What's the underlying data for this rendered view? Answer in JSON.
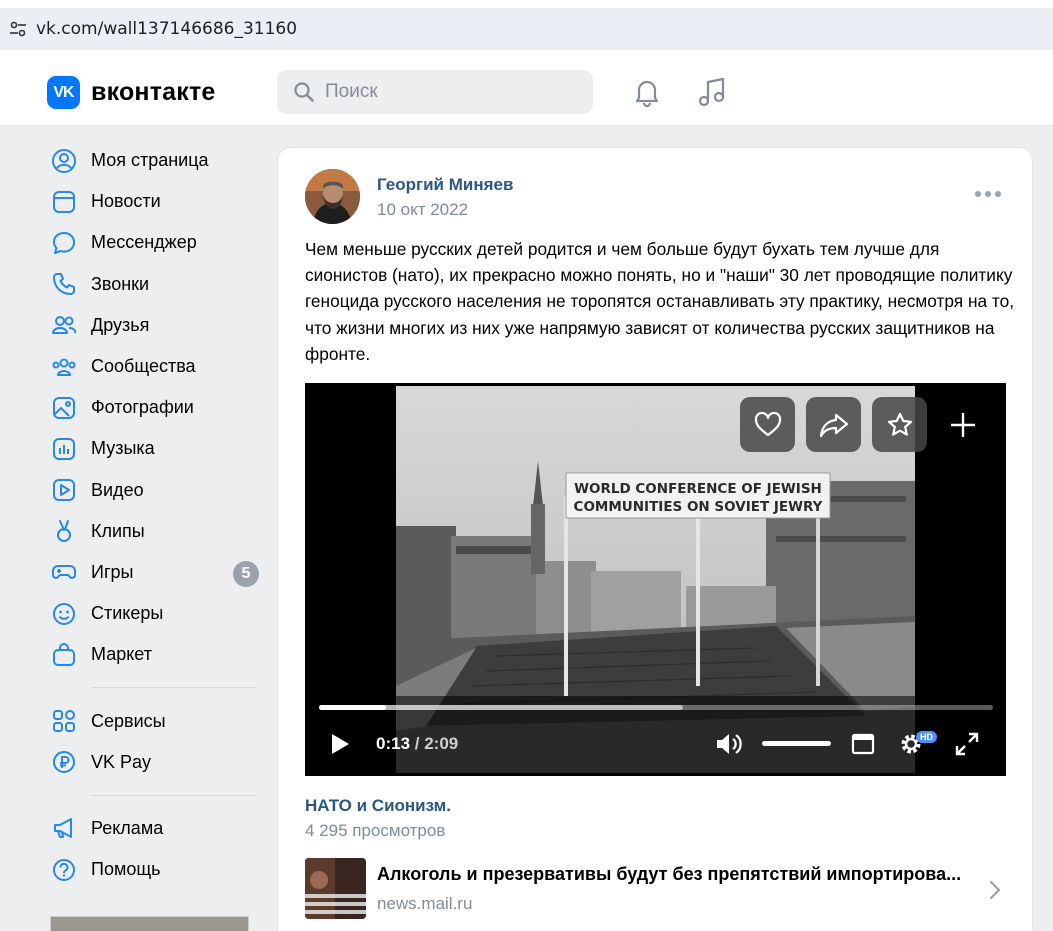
{
  "browser": {
    "url": "vk.com/wall137146686_31160"
  },
  "header": {
    "logo_mark": "VK",
    "logo_text": "вконтакте",
    "search_placeholder": "Поиск"
  },
  "sidebar": {
    "items": [
      {
        "label": "Моя страница",
        "icon": "user-circle-icon"
      },
      {
        "label": "Новости",
        "icon": "newspaper-icon"
      },
      {
        "label": "Мессенджер",
        "icon": "chat-bubble-icon"
      },
      {
        "label": "Звонки",
        "icon": "phone-icon"
      },
      {
        "label": "Друзья",
        "icon": "users-icon"
      },
      {
        "label": "Сообщества",
        "icon": "communities-icon"
      },
      {
        "label": "Фотографии",
        "icon": "photo-icon"
      },
      {
        "label": "Музыка",
        "icon": "music-bars-icon"
      },
      {
        "label": "Видео",
        "icon": "video-play-icon"
      },
      {
        "label": "Клипы",
        "icon": "clips-icon"
      },
      {
        "label": "Игры",
        "icon": "gamepad-icon",
        "badge": "5"
      },
      {
        "label": "Стикеры",
        "icon": "smiley-icon"
      },
      {
        "label": "Маркет",
        "icon": "shopping-bag-icon"
      }
    ],
    "secondary": [
      {
        "label": "Сервисы",
        "icon": "grid-icon"
      },
      {
        "label": "VK Pay",
        "icon": "ruble-icon"
      }
    ],
    "tertiary": [
      {
        "label": "Реклама",
        "icon": "megaphone-icon"
      },
      {
        "label": "Помощь",
        "icon": "help-icon"
      }
    ]
  },
  "post": {
    "author": "Георгий Миняев",
    "date": "10 окт 2022",
    "text": "Чем меньше русских детей родится и чем больше будут бухать тем лучше для сионистов (нато), их прекрасно можно понять, но и \"наши\" 30 лет проводящие политику геноцида русского населения не торопятся останавливать эту практику, несмотря на то, что жизни многих из них уже напрямую зависят от количества русских защитников на фронте.",
    "video": {
      "banner_line1": "WORLD CONFERENCE OF JEWISH",
      "banner_line2": "COMMUNITIES ON SOVIET JEWRY",
      "current_time": "0:13",
      "duration": "/ 2:09",
      "progress": 0.1,
      "buffered": 0.54,
      "hd_badge": "HD",
      "title": "НАТО и Сионизм.",
      "views": "4 295 просмотров"
    },
    "link": {
      "title": "Алкоголь и презервативы будут без препятствий импортирова...",
      "domain": "news.mail.ru"
    }
  }
}
